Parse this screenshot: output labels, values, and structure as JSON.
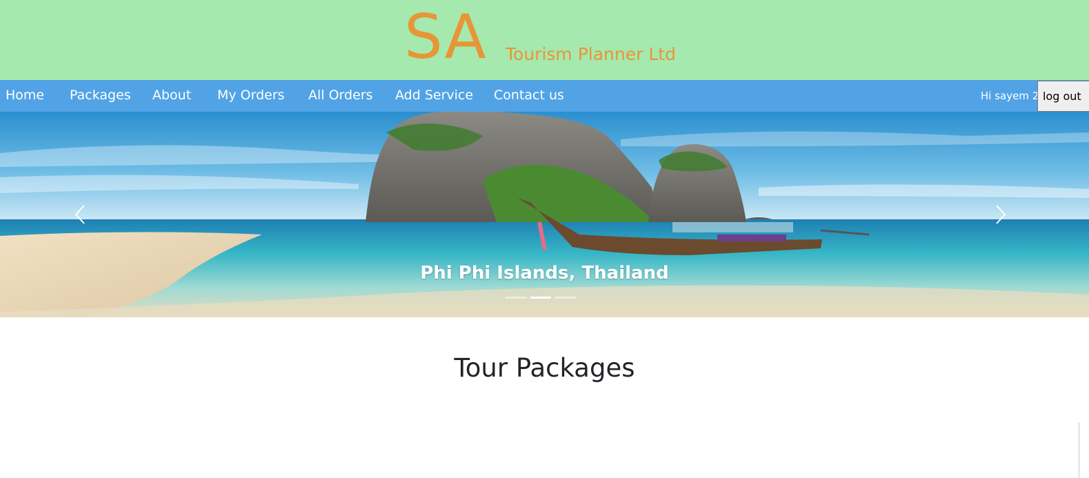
{
  "brand": {
    "logo_text": "SA",
    "company_name": "Tourism Planner Ltd",
    "color": "#e69637"
  },
  "nav": {
    "items": [
      {
        "label": "Home"
      },
      {
        "label": "Packages"
      },
      {
        "label": "About"
      },
      {
        "label": "My Orders"
      },
      {
        "label": "All Orders"
      },
      {
        "label": "Add Service"
      },
      {
        "label": "Contact us"
      }
    ],
    "greeting": "Hi sayem 2",
    "logout_label": "log out"
  },
  "carousel": {
    "caption": "Phi Phi Islands, Thailand",
    "prev_icon": "chevron-left-icon",
    "next_icon": "chevron-right-icon",
    "slide_count": 3,
    "active_slide": 2
  },
  "section": {
    "title": "Tour Packages"
  },
  "colors": {
    "header_bg": "#a6e9ae",
    "navbar_bg": "#51a3e6",
    "heading_text": "#212529"
  }
}
